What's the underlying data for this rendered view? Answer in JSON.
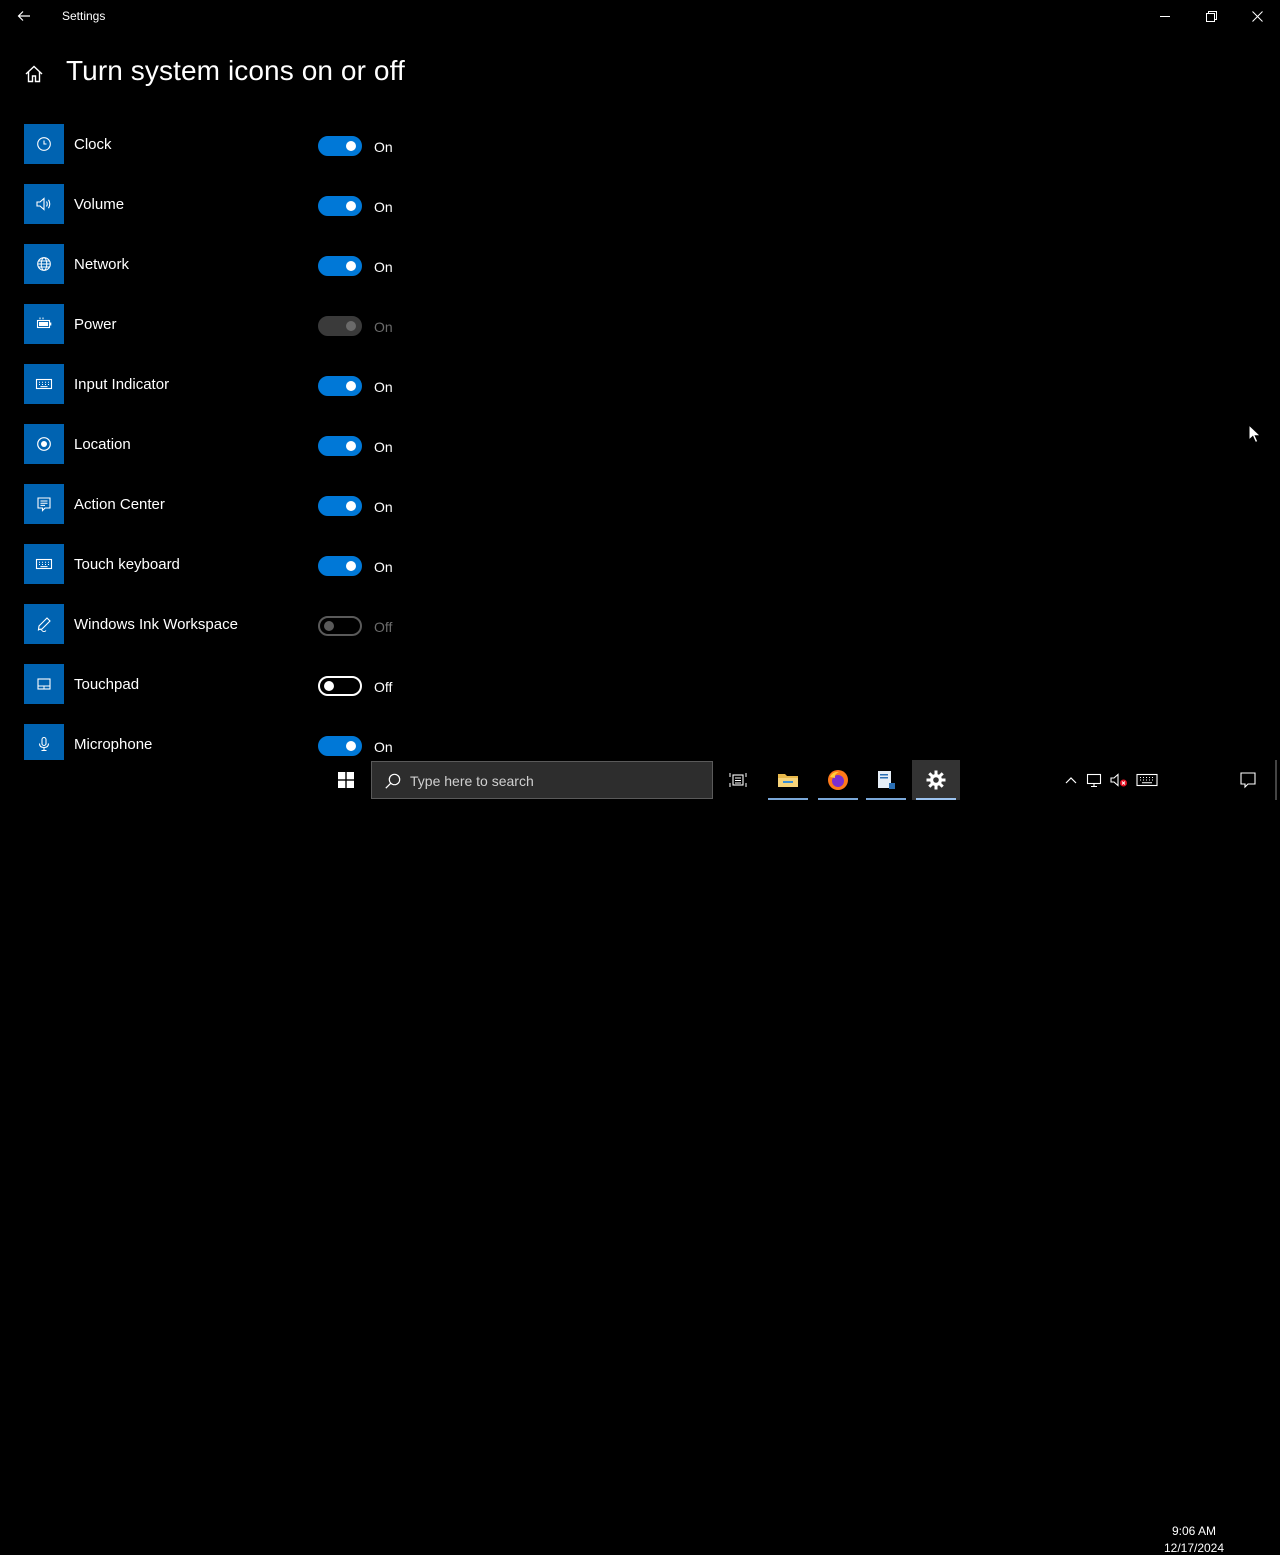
{
  "window": {
    "title": "Settings"
  },
  "header": {
    "title": "Turn system icons on or off"
  },
  "items": [
    {
      "label": "Clock",
      "state": "On",
      "icon": "clock-icon"
    },
    {
      "label": "Volume",
      "state": "On",
      "icon": "volume-icon"
    },
    {
      "label": "Network",
      "state": "On",
      "icon": "network-icon"
    },
    {
      "label": "Power",
      "state": "On",
      "icon": "battery-icon",
      "disabled": true
    },
    {
      "label": "Input Indicator",
      "state": "On",
      "icon": "keyboard-icon"
    },
    {
      "label": "Location",
      "state": "On",
      "icon": "location-icon"
    },
    {
      "label": "Action Center",
      "state": "On",
      "icon": "action-center-icon"
    },
    {
      "label": "Touch keyboard",
      "state": "On",
      "icon": "keyboard-icon"
    },
    {
      "label": "Windows Ink Workspace",
      "state": "Off",
      "icon": "pen-icon",
      "disabled": true
    },
    {
      "label": "Touchpad",
      "state": "Off",
      "icon": "touchpad-icon"
    },
    {
      "label": "Microphone",
      "state": "On",
      "icon": "microphone-icon"
    }
  ],
  "taskbar": {
    "search_placeholder": "Type here to search",
    "apps": [
      "task-view-icon",
      "file-explorer-icon",
      "firefox-icon",
      "document-app-icon",
      "settings-icon"
    ],
    "active_app": "settings-icon",
    "tray": [
      "chevron-up-icon",
      "network-icon",
      "volume-muted-icon",
      "keyboard-icon"
    ],
    "time": "9:06 AM",
    "date": "12/17/2024"
  },
  "colors": {
    "accent": "#0078d7",
    "icon_tile": "#0063b1",
    "background": "#000000"
  }
}
